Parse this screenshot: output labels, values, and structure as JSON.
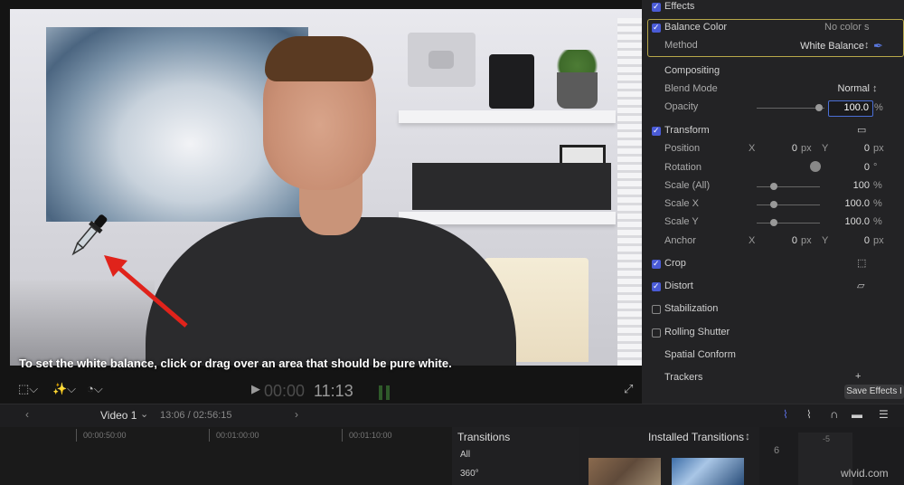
{
  "viewer": {
    "caption": "To set the white balance, click or drag over an area that should be pure white.",
    "timecode_dim": "00:00",
    "timecode": "11:13"
  },
  "inspector": {
    "effects_label": "Effects",
    "balance_color_label": "Balance Color",
    "balance_color_value": "No color s",
    "method_label": "Method",
    "method_value": "White Balance",
    "compositing_label": "Compositing",
    "blend_mode_label": "Blend Mode",
    "blend_mode_value": "Normal",
    "opacity_label": "Opacity",
    "opacity_value": "100.0",
    "opacity_unit": "%",
    "opacity_level": 1.0,
    "transform_label": "Transform",
    "position_label": "Position",
    "position_x_axis": "X",
    "position_x": "0",
    "position_y_axis": "Y",
    "position_y": "0",
    "px_unit": "px",
    "rotation_label": "Rotation",
    "rotation_value": "0",
    "degree_unit": "°",
    "scale_all_label": "Scale (All)",
    "scale_all_value": "100",
    "scale_x_label": "Scale X",
    "scale_x_value": "100.0",
    "scale_y_label": "Scale Y",
    "scale_y_value": "100.0",
    "percent_unit": "%",
    "anchor_label": "Anchor",
    "anchor_x_axis": "X",
    "anchor_x": "0",
    "anchor_y_axis": "Y",
    "anchor_y": "0",
    "crop_label": "Crop",
    "distort_label": "Distort",
    "stabilization_label": "Stabilization",
    "rolling_shutter_label": "Rolling Shutter",
    "spatial_conform_label": "Spatial Conform",
    "trackers_label": "Trackers",
    "save_effects_label": "Save Effects I"
  },
  "timeline": {
    "project_name": "Video 1",
    "position": "13:06 / 02:56:15",
    "ticks": [
      "00:00:50:00",
      "00:01:00:00",
      "00:01:10:00"
    ]
  },
  "transitions": {
    "title": "Transitions",
    "categories": [
      "All",
      "360°"
    ],
    "installed_label": "Installed Transitions"
  },
  "audio": {
    "scale_left": "-5",
    "scale_right": "6",
    "watermark": "wlvid.com"
  }
}
